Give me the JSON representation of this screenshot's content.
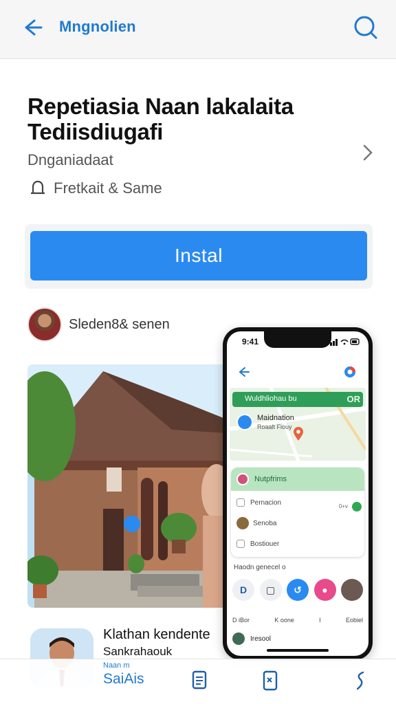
{
  "header": {
    "title": "Mngnolien",
    "back_icon": "arrow-left-icon",
    "search_icon": "search-icon"
  },
  "app": {
    "title": "Repetiasia Naan lakalaita Tediisdiugafi",
    "developer": "Dnganiadaat",
    "rating_text": "Fretkait & Same",
    "install_label": "Instal",
    "accent_color": "#2b8af0"
  },
  "author": {
    "name": "Sleden8& senen"
  },
  "phone_screen": {
    "time": "9:41",
    "search_text": "Wuldhliohau bu",
    "search_tag": "OR",
    "location_title": "Maidnation",
    "location_sub": "Roaalt Fiouy",
    "card_title": "Nutpfrims",
    "rows": [
      "Pernacion",
      "Senoba",
      "Bostiouer"
    ],
    "row_check_label": "0+v",
    "section_label": "Haodn genecel o",
    "tabs": [
      "D iBor",
      "K  oone",
      "I",
      "Eobiel"
    ],
    "bottom_row": "Iresool"
  },
  "review": {
    "name": "Klathan kendente",
    "subtitle": "Sankrahaouk"
  },
  "bottom_nav": {
    "label_top": "Naan m",
    "label": "SaiAis"
  }
}
